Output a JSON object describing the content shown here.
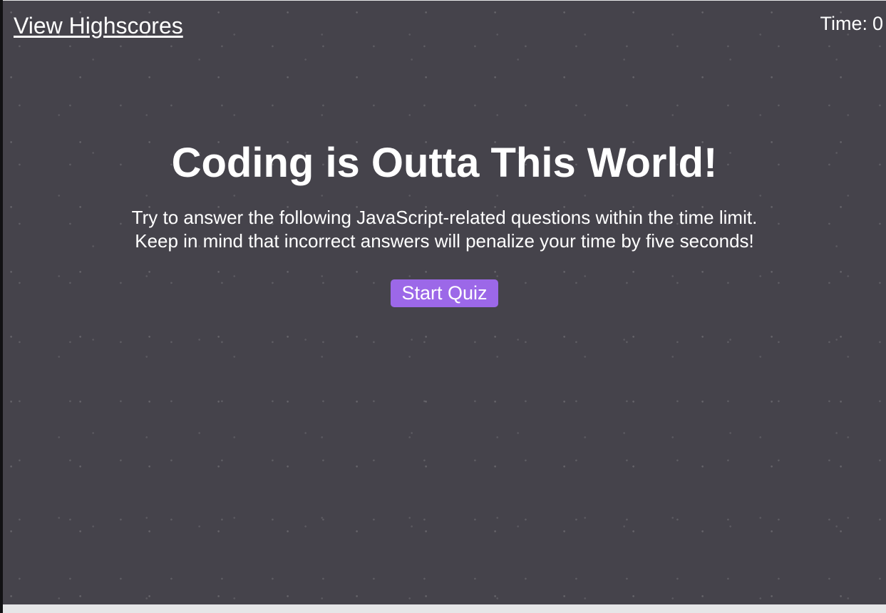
{
  "header": {
    "highscores_link": "View Highscores",
    "timer_label": "Time:",
    "timer_value": "0"
  },
  "main": {
    "title": "Coding is Outta This World!",
    "intro": "Try to answer the following JavaScript-related questions within the time limit. Keep in mind that incorrect answers will penalize your time by five seconds!",
    "start_button": "Start Quiz"
  },
  "colors": {
    "background": "#45434b",
    "text": "#ffffff",
    "button_accent": "#9c68e8"
  }
}
